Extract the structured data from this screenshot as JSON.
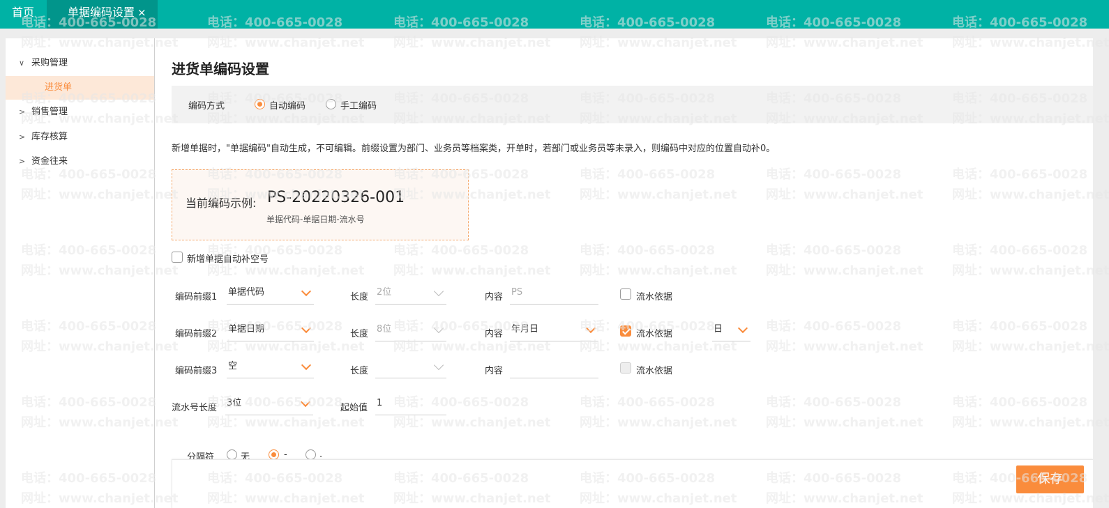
{
  "tabs": {
    "home": "首页",
    "active": "单据编码设置",
    "close_glyph": "×"
  },
  "sidebar": {
    "groups": [
      {
        "label": "采购管理",
        "arrow": "∨"
      },
      {
        "label": "销售管理",
        "arrow": ">"
      },
      {
        "label": "库存核算",
        "arrow": ">"
      },
      {
        "label": "资金往来",
        "arrow": ">"
      }
    ],
    "sub_item": "进货单"
  },
  "page": {
    "title": "进货单编码设置"
  },
  "mode": {
    "label": "编码方式",
    "options": [
      "自动编码",
      "手工编码"
    ],
    "selected": "自动编码"
  },
  "description": "新增单据时，\"单据编码\"自动生成，不可编辑。前缀设置为部门、业务员等档案类，开单时，若部门或业务员等未录入，则编码中对应的位置自动补0。",
  "example": {
    "label": "当前编码示例:",
    "code": "PS-20220326-001",
    "format": "单据代码-单据日期-流水号"
  },
  "auto_fill": {
    "label": "新增单据自动补空号",
    "checked": false
  },
  "prefixes": [
    {
      "label": "编码前缀1",
      "type": "单据代码",
      "length_label": "长度",
      "length": "2位",
      "content_label": "内容",
      "content": "PS",
      "flow_label": "流水依据",
      "flow_checked": false
    },
    {
      "label": "编码前缀2",
      "type": "单据日期",
      "length_label": "长度",
      "length": "8位",
      "content_label": "内容",
      "content": "年月日",
      "flow_label": "流水依据",
      "flow_checked": true,
      "flow_unit": "日"
    },
    {
      "label": "编码前缀3",
      "type": "空",
      "length_label": "长度",
      "length": "",
      "content_label": "内容",
      "content": "",
      "flow_label": "流水依据",
      "flow_checked": false
    }
  ],
  "serial": {
    "label": "流水号长度",
    "value": "3位",
    "start_label": "起始值",
    "start_value": "1"
  },
  "separator": {
    "label": "分隔符",
    "options": [
      "无",
      "-",
      "."
    ],
    "selected": "-"
  },
  "actions": {
    "save": "保存"
  },
  "watermark": {
    "phone": "电话：400-665-0028",
    "site": "网址：www.chanjet.net"
  },
  "colors": {
    "topbar": "#00b2a5",
    "active_tab": "#01958b",
    "accent": "#fa8c3c"
  }
}
